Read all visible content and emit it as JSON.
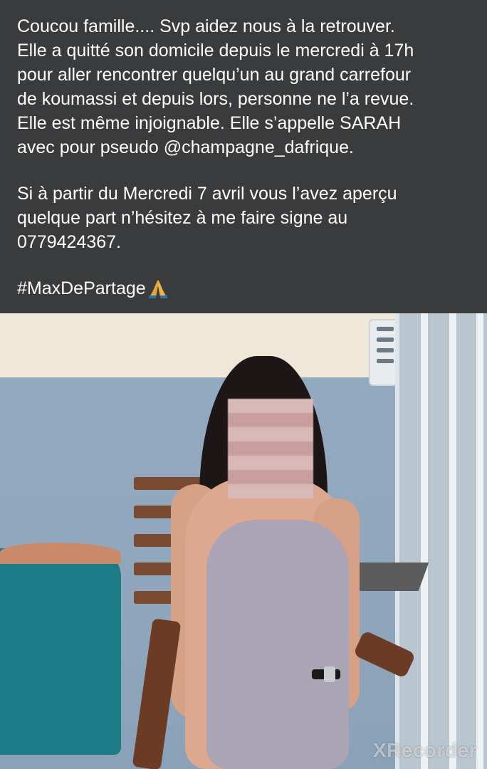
{
  "post": {
    "lines": [
      "Coucou famille.... Svp aidez nous à la retrouver.",
      "Elle a quitté son domicile depuis le mercredi à 17h",
      "pour aller rencontrer quelqu’un au grand carrefour",
      "de koumassi et depuis lors, personne ne l’a revue.",
      "Elle est même injoignable. Elle s’appelle SARAH",
      "avec pour pseudo @champagne_dafrique.",
      "Si à partir du Mercredi 7 avril vous l’avez aperçu",
      "quelque part n’hésitez à me faire signe au",
      "0779424367."
    ],
    "hashtag": "#MaxDePartage",
    "emoji": "praying-hands-icon"
  },
  "photo": {
    "watermark": "XRecorder"
  },
  "colors": {
    "background": "#3a3b3c",
    "text": "#ffffff"
  }
}
